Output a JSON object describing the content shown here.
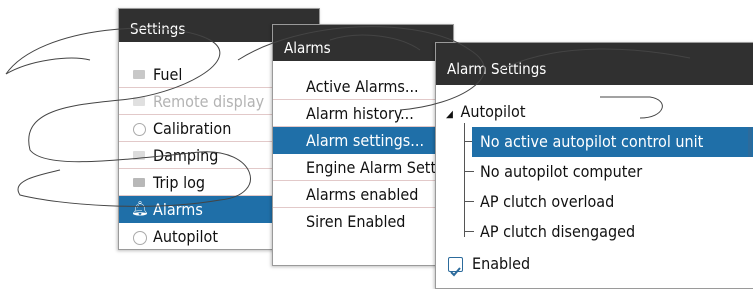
{
  "settings_panel": {
    "title": "Settings",
    "items": [
      {
        "label": "Fuel",
        "icon": "fuel-icon"
      },
      {
        "label": "Remote display",
        "icon": "remote-display-icon",
        "dimmed": true
      },
      {
        "label": "Calibration",
        "icon": "calibration-icon"
      },
      {
        "label": "Damping",
        "icon": "damping-icon"
      },
      {
        "label": "Trip log",
        "icon": "trip-log-icon"
      },
      {
        "label": "Alarms",
        "icon": "bell-icon",
        "selected": true
      },
      {
        "label": "Autopilot",
        "icon": "autopilot-icon"
      }
    ]
  },
  "alarms_panel": {
    "title": "Alarms",
    "items": [
      {
        "label": "Active Alarms..."
      },
      {
        "label": "Alarm history..."
      },
      {
        "label": "Alarm settings...",
        "selected": true
      },
      {
        "label": "Engine Alarm Settings"
      },
      {
        "label": "Alarms enabled"
      },
      {
        "label": "Siren Enabled"
      }
    ]
  },
  "alarm_settings_panel": {
    "title": "Alarm Settings",
    "group": "Autopilot",
    "items": [
      {
        "label": "No active autopilot control unit",
        "selected": true
      },
      {
        "label": "No autopilot computer"
      },
      {
        "label": "AP clutch overload"
      },
      {
        "label": "AP clutch disengaged"
      }
    ],
    "enabled_label": "Enabled",
    "enabled_checked": true
  },
  "colors": {
    "titlebar": "#303030",
    "selection": "#1f6fa8",
    "row_rule": "#e2c9c9",
    "watermark_outline": "#444444"
  }
}
